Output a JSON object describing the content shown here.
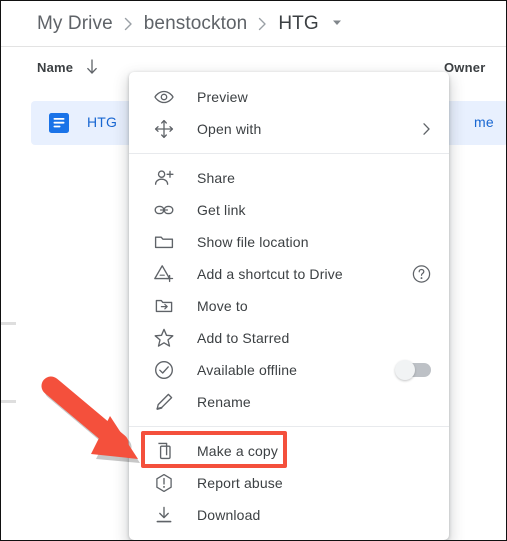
{
  "app": {
    "name": "Google Drive",
    "accent_blue": "#1967d2",
    "row_highlight": "#e8f0fe",
    "annotation_red": "#f4503c",
    "text_primary": "#3c4043",
    "text_secondary": "#5f6368"
  },
  "breadcrumb": {
    "items": [
      {
        "label": "My Drive"
      },
      {
        "label": "benstockton"
      },
      {
        "label": "HTG"
      }
    ],
    "separator_icon": "chevron-right-icon",
    "caret_icon": "caret-down-icon"
  },
  "list_header": {
    "name_label": "Name",
    "sort_icon": "arrow-down-icon",
    "owner_label": "Owner"
  },
  "file_row": {
    "icon": "google-docs-icon",
    "name": "HTG",
    "owner": "me"
  },
  "context_menu": {
    "groups": [
      {
        "items": [
          {
            "icon": "eye-icon",
            "label": "Preview",
            "trailing": "none"
          },
          {
            "icon": "open-with-icon",
            "label": "Open with",
            "trailing": "chevron-right-icon"
          }
        ]
      },
      {
        "items": [
          {
            "icon": "person-add-icon",
            "label": "Share",
            "trailing": "none"
          },
          {
            "icon": "link-icon",
            "label": "Get link",
            "trailing": "none"
          },
          {
            "icon": "folder-icon",
            "label": "Show file location",
            "trailing": "none"
          },
          {
            "icon": "add-shortcut-icon",
            "label": "Add a shortcut to Drive",
            "trailing": "help-icon"
          },
          {
            "icon": "move-to-icon",
            "label": "Move to",
            "trailing": "none"
          },
          {
            "icon": "star-icon",
            "label": "Add to Starred",
            "trailing": "none"
          },
          {
            "icon": "offline-check-icon",
            "label": "Available offline",
            "trailing": "toggle-off"
          },
          {
            "icon": "pencil-icon",
            "label": "Rename",
            "trailing": "none"
          }
        ]
      },
      {
        "items": [
          {
            "icon": "copy-icon",
            "label": "Make a copy",
            "trailing": "none",
            "highlighted": true
          },
          {
            "icon": "report-abuse-icon",
            "label": "Report abuse",
            "trailing": "none"
          },
          {
            "icon": "download-icon",
            "label": "Download",
            "trailing": "none"
          }
        ]
      }
    ]
  },
  "annotation": {
    "arrow_color": "#f4503c",
    "points_to": "Make a copy"
  }
}
